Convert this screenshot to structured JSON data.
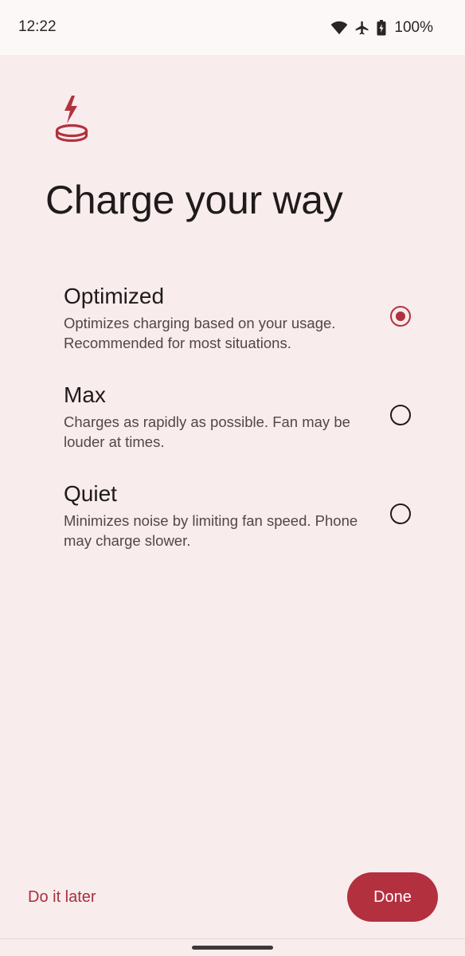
{
  "status_bar": {
    "time": "12:22",
    "battery_percent": "100%",
    "icons": [
      "wifi-icon",
      "airplane-mode-icon",
      "battery-charging-icon"
    ]
  },
  "header": {
    "icon": "wireless-charging-icon",
    "title": "Charge your way"
  },
  "options": [
    {
      "title": "Optimized",
      "description": "Optimizes charging based on your usage. Recommended for most situations.",
      "selected": true
    },
    {
      "title": "Max",
      "description": "Charges as rapidly as possible. Fan may be louder at times.",
      "selected": false
    },
    {
      "title": "Quiet",
      "description": "Minimizes noise by limiting fan speed. Phone may charge slower.",
      "selected": false
    }
  ],
  "footer": {
    "later_label": "Do it later",
    "done_label": "Done"
  },
  "colors": {
    "accent": "#b3303f",
    "background": "#f9eced",
    "status_bar": "#fdf8f8"
  }
}
